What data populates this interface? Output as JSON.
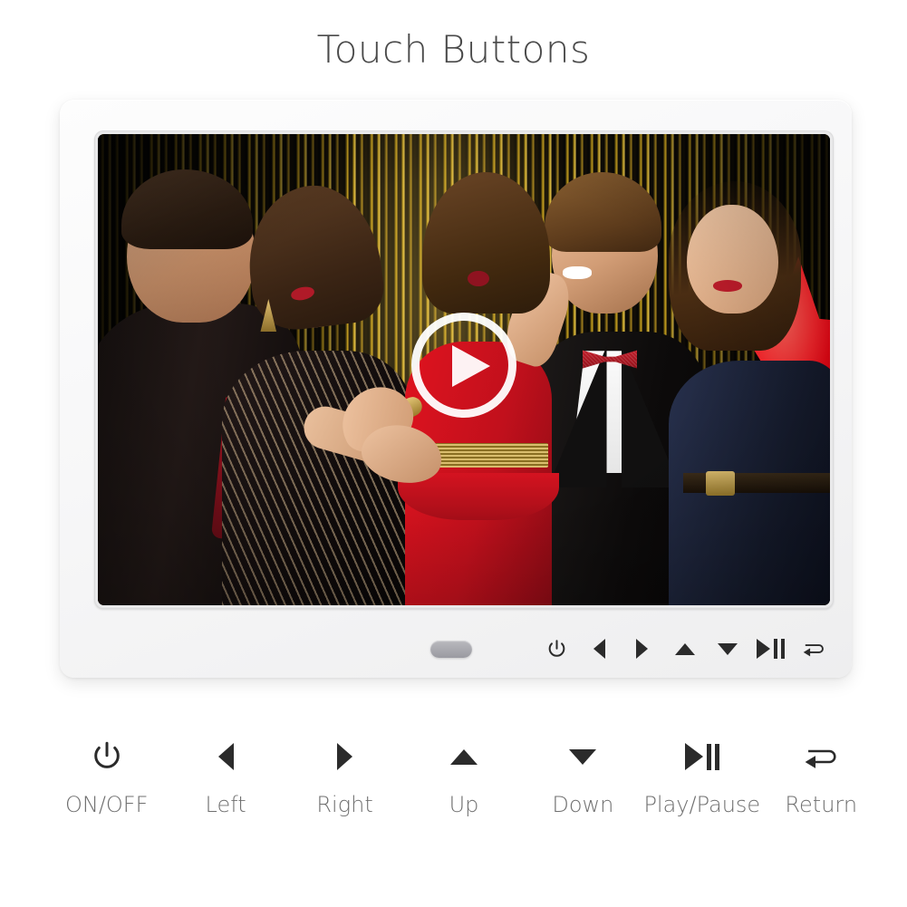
{
  "page": {
    "title": "Touch Buttons",
    "background_color": "#ffffff",
    "title_color": "#4a4a4a"
  },
  "device": {
    "name": "digital-photo-frame",
    "body_color": "#f7f7f8",
    "bezel_color": "#e9e9ea",
    "sensor_label": "ir-sensor",
    "screen": {
      "media_state": "paused",
      "play_overlay_label": "play",
      "photo_description": "Five people in formal attire posing in front of a gold and black metallic fringe party backdrop"
    },
    "touch_buttons": [
      {
        "icon": "power-icon",
        "name": "on-off"
      },
      {
        "icon": "triangle-left-icon",
        "name": "left"
      },
      {
        "icon": "triangle-right-icon",
        "name": "right"
      },
      {
        "icon": "triangle-up-icon",
        "name": "up"
      },
      {
        "icon": "triangle-down-icon",
        "name": "down"
      },
      {
        "icon": "play-pause-icon",
        "name": "play-pause"
      },
      {
        "icon": "return-icon",
        "name": "return"
      }
    ]
  },
  "legend": {
    "icon_color": "#2b2b2b",
    "label_color": "#6f6f6f",
    "items": [
      {
        "icon": "power-icon",
        "label": "ON/OFF"
      },
      {
        "icon": "triangle-left-icon",
        "label": "Left"
      },
      {
        "icon": "triangle-right-icon",
        "label": "Right"
      },
      {
        "icon": "triangle-up-icon",
        "label": "Up"
      },
      {
        "icon": "triangle-down-icon",
        "label": "Down"
      },
      {
        "icon": "play-pause-icon",
        "label": "Play/Pause"
      },
      {
        "icon": "return-icon",
        "label": "Return"
      }
    ]
  }
}
